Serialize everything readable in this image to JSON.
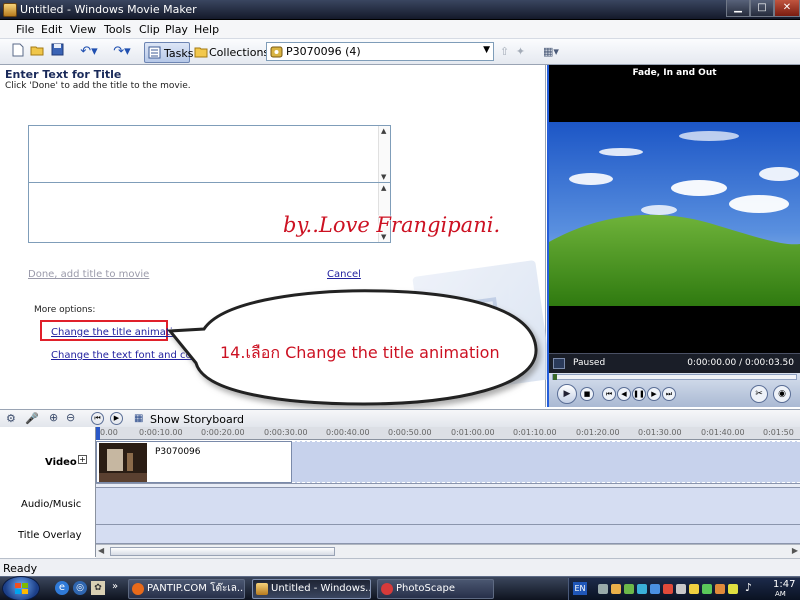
{
  "window": {
    "title": "Untitled - Windows Movie Maker"
  },
  "menu": [
    "File",
    "Edit",
    "View",
    "Tools",
    "Clip",
    "Play",
    "Help"
  ],
  "toolbar": {
    "tasks_label": "Tasks",
    "collections_label": "Collections",
    "collection_combo_value": "P3070096 (4)"
  },
  "left_pane": {
    "heading": "Enter Text for Title",
    "instruction": "Click 'Done' to add the title to the movie.",
    "done_link": "Done, add title to movie",
    "cancel_link": "Cancel",
    "more_options_label": "More options:",
    "change_animation_link": "Change the title animation",
    "change_font_link": "Change the text font and color"
  },
  "overlay": {
    "watermark_text": "by..Love Frangipani.",
    "callout_text": "14.เลือก Change the title animation"
  },
  "preview": {
    "title": "Fade, In and Out",
    "status": "Paused",
    "timecode": "0:00:00.00 / 0:00:03.50"
  },
  "timeline": {
    "show_storyboard_label": "Show Storyboard",
    "ruler_ticks": [
      "0.00",
      "0:00:10.00",
      "0:00:20.00",
      "0:00:30.00",
      "0:00:40.00",
      "0:00:50.00",
      "0:01:00.00",
      "0:01:10.00",
      "0:01:20.00",
      "0:01:30.00",
      "0:01:40.00",
      "0:01:50"
    ],
    "tracks": {
      "video": "Video",
      "audio_music": "Audio/Music",
      "title_overlay": "Title Overlay"
    },
    "clip_name": "P3070096"
  },
  "statusbar": {
    "text": "Ready"
  },
  "taskbar": {
    "items": [
      "PANTIP.COM โต๊ะเล...",
      "Untitled - Windows...",
      "PhotoScape"
    ],
    "language": "EN",
    "clock": "1:47",
    "clock_ampm": "AM"
  },
  "colors": {
    "accent": "#245edb",
    "highlight_red": "#e0202a",
    "callout_text": "#cc1122"
  }
}
